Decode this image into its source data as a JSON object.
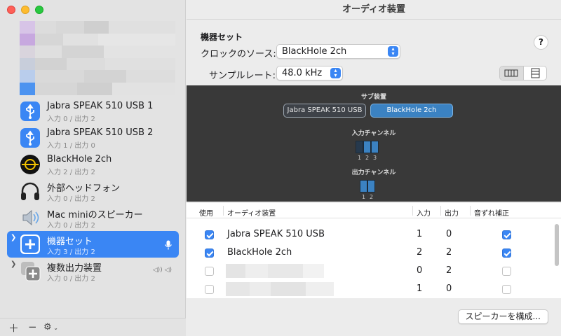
{
  "window": {
    "title": "オーディオ装置"
  },
  "sidebar": {
    "devices": [
      {
        "name": "Jabra SPEAK 510 USB 1",
        "io": "入力 0 / 出力 2",
        "icon": "usb-icon",
        "selected": false,
        "expandable": false
      },
      {
        "name": "Jabra SPEAK 510 USB 2",
        "io": "入力 1 / 出力 0",
        "icon": "usb-icon",
        "selected": false,
        "expandable": false
      },
      {
        "name": "BlackHole 2ch",
        "io": "入力 2 / 出力 2",
        "icon": "blackhole-icon",
        "selected": false,
        "expandable": false
      },
      {
        "name": "外部ヘッドフォン",
        "io": "入力 0 / 出力 2",
        "icon": "headphones-icon",
        "selected": false,
        "expandable": false
      },
      {
        "name": "Mac miniのスピーカー",
        "io": "入力 0 / 出力 2",
        "icon": "speaker-icon",
        "selected": false,
        "expandable": false
      },
      {
        "name": "機器セット",
        "io": "入力 3 / 出力 2",
        "icon": "aggregate-device-icon",
        "selected": true,
        "expandable": true,
        "right_icon": "microphone-icon"
      },
      {
        "name": "複数出力装置",
        "io": "入力 0 / 出力 2",
        "icon": "multi-output-icon",
        "selected": false,
        "expandable": true,
        "right_icon": "volume-indicator-icon",
        "right_text": "◁)) ◁)"
      }
    ],
    "bottom": {
      "add": "＋",
      "remove": "−",
      "gear": "⚙"
    }
  },
  "main": {
    "group_title": "機器セット",
    "help": "?",
    "clock_label": "クロックのソース:",
    "clock_value": "BlackHole 2ch",
    "rate_label": "サンプルレート:",
    "rate_value": "48.0 kHz",
    "view_toggle": [
      "columns",
      "rows"
    ]
  },
  "preview": {
    "subdevices_title": "サブ装置",
    "subdevices": [
      "Jabra SPEAK 510 USB",
      "BlackHole 2ch"
    ],
    "input_title": "入力チャンネル",
    "input_channels": [
      "1",
      "2",
      "3"
    ],
    "output_title": "出力チャンネル",
    "output_channels": [
      "1",
      "2"
    ],
    "colors": {
      "jabra": "#1c2a38",
      "blackhole": "#3b82c2"
    }
  },
  "table": {
    "headers": {
      "use": "使用",
      "device": "オーディオ装置",
      "input": "入力",
      "output": "出力",
      "drift": "音ずれ補正"
    },
    "rows": [
      {
        "use": true,
        "name": "Jabra SPEAK 510 USB",
        "input": "1",
        "output": "0",
        "drift": true
      },
      {
        "use": true,
        "name": "BlackHole 2ch",
        "input": "2",
        "output": "2",
        "drift": true
      },
      {
        "use": false,
        "name": "",
        "input": "0",
        "output": "2",
        "drift": false
      },
      {
        "use": false,
        "name": "",
        "input": "1",
        "output": "0",
        "drift": false
      }
    ]
  },
  "footer": {
    "configure_speakers": "スピーカーを構成..."
  }
}
